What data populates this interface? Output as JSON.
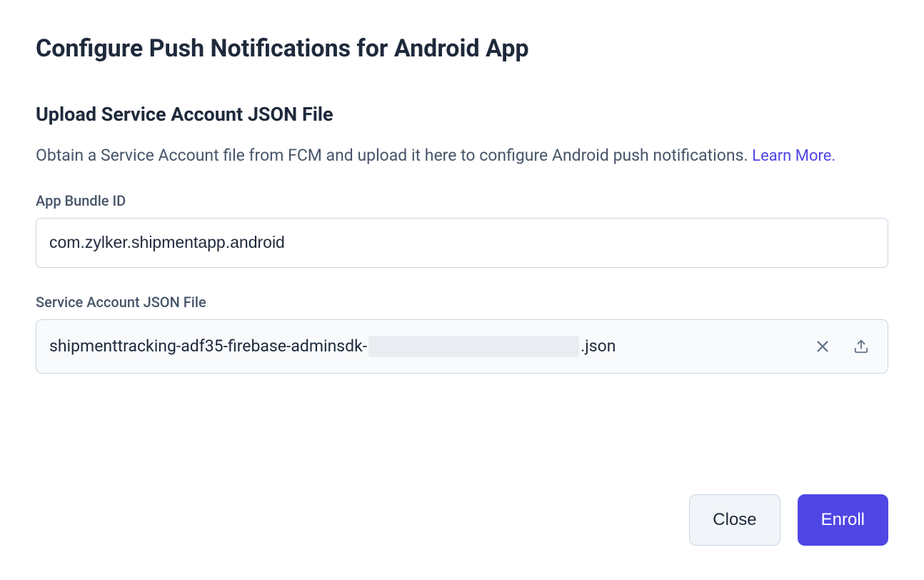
{
  "modal": {
    "title": "Configure Push Notifications for Android App"
  },
  "section": {
    "title": "Upload Service Account JSON File",
    "description_prefix": "Obtain a Service Account file from FCM and upload it here to configure Android push notifications. ",
    "learn_more_label": "Learn More."
  },
  "fields": {
    "bundle_id": {
      "label": "App Bundle ID",
      "value": "com.zylker.shipmentapp.android"
    },
    "json_file": {
      "label": "Service Account JSON File",
      "filename_prefix": "shipmenttracking-adf35-firebase-adminsdk-",
      "filename_suffix": ".json"
    }
  },
  "buttons": {
    "close": "Close",
    "enroll": "Enroll"
  }
}
